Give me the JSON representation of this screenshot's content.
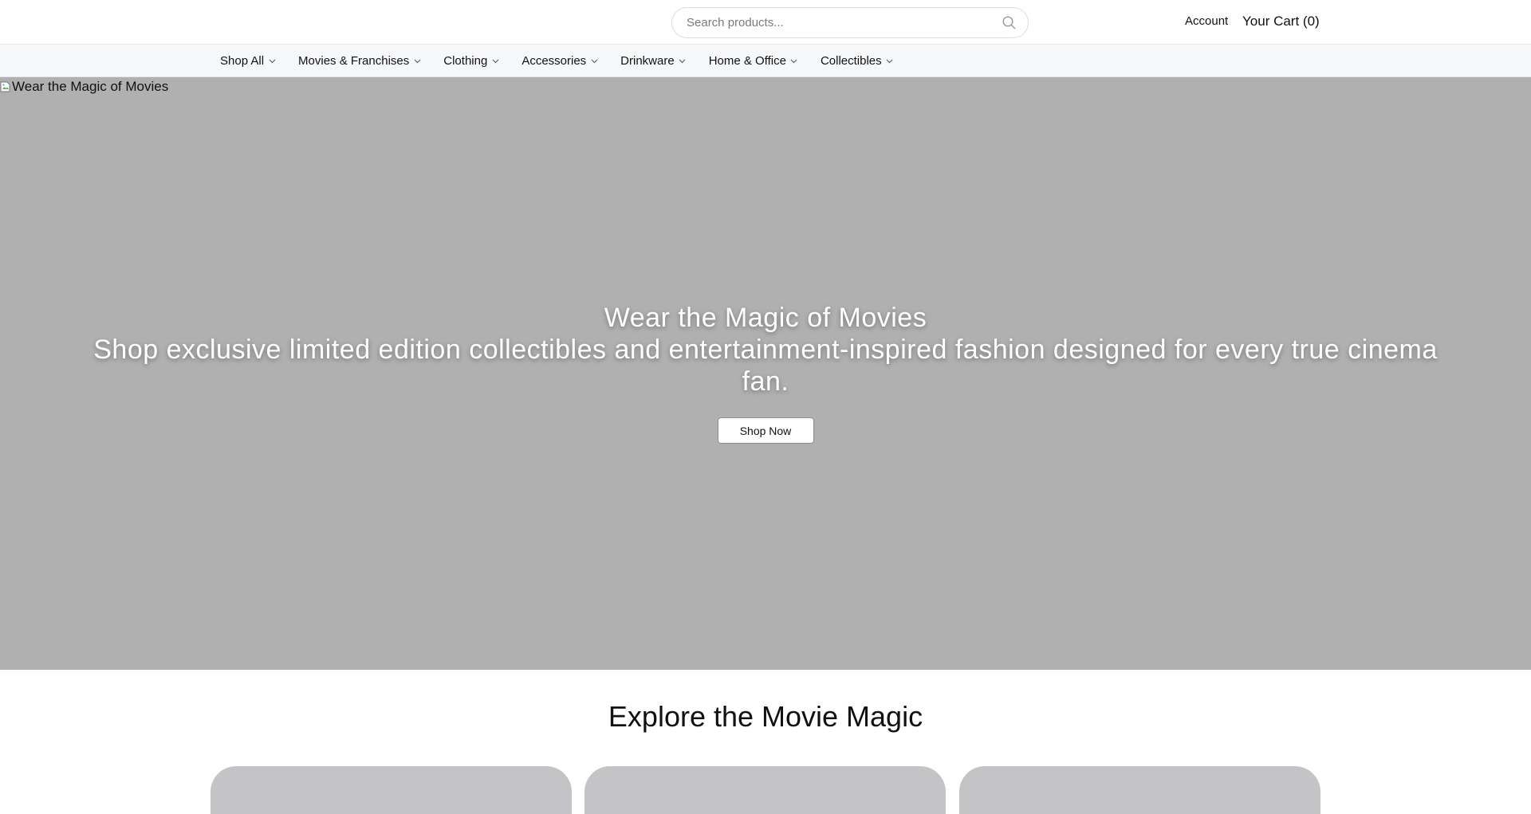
{
  "header": {
    "search_placeholder": "Search products...",
    "account_label": "Account",
    "cart_label": "Your Cart (0)"
  },
  "nav": {
    "items": [
      {
        "label": "Shop All"
      },
      {
        "label": "Movies & Franchises"
      },
      {
        "label": "Clothing"
      },
      {
        "label": "Accessories"
      },
      {
        "label": "Drinkware"
      },
      {
        "label": "Home & Office"
      },
      {
        "label": "Collectibles"
      }
    ]
  },
  "hero": {
    "image_alt": "Wear the Magic of Movies",
    "title": "Wear the Magic of Movies",
    "subtitle": "Shop exclusive limited edition collectibles and entertainment-inspired fashion designed for every true cinema fan.",
    "cta_label": "Shop Now"
  },
  "explore": {
    "title": "Explore the Movie Magic"
  },
  "icons": {
    "search": "search-icon",
    "chevron": "chevron-down-icon",
    "broken_image": "broken-image-icon"
  },
  "colors": {
    "hero_bg": "#b0b0b0",
    "nav_bg": "#f7f8fa",
    "card_bg": "#c4c4c6"
  }
}
